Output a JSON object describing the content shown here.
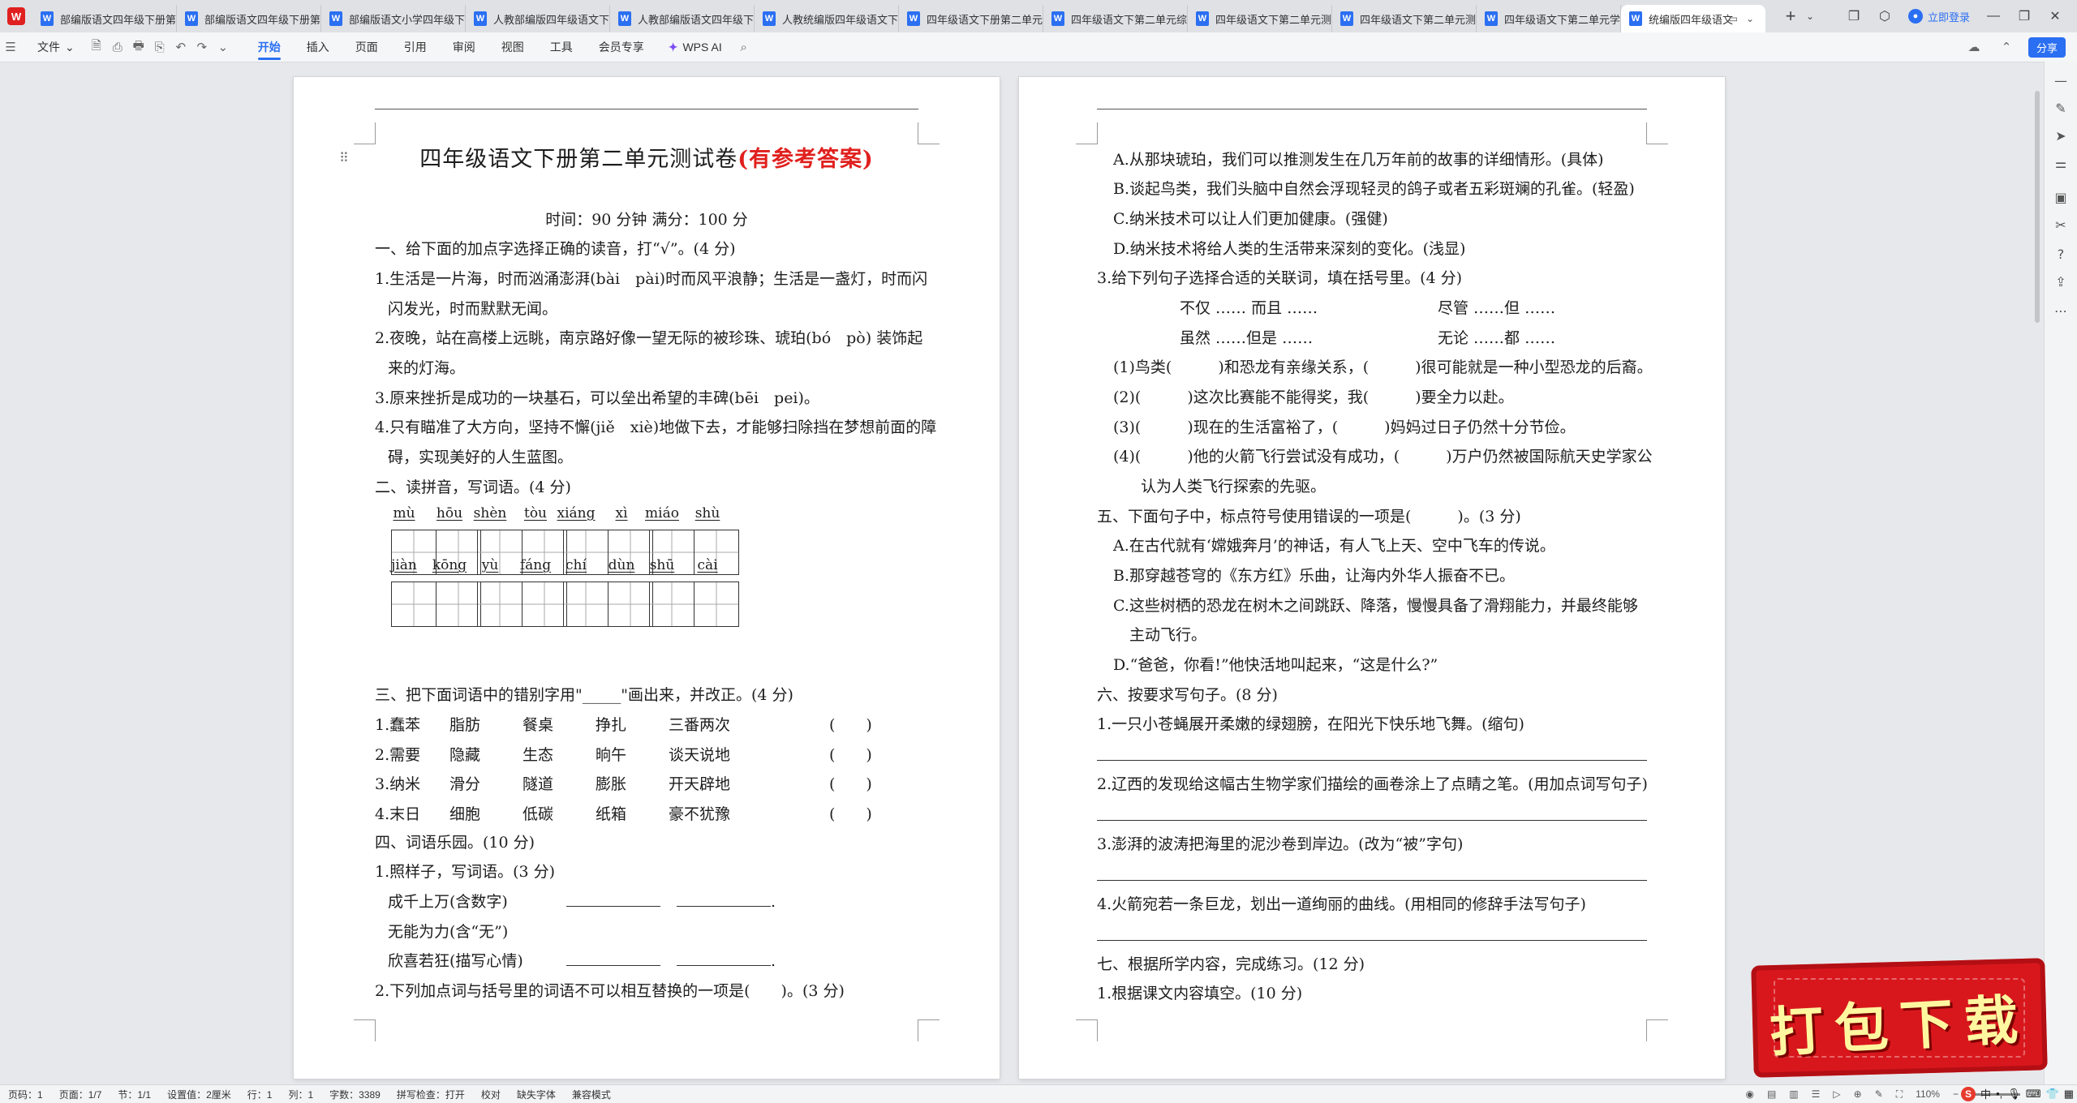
{
  "tabbar": {
    "tabs": [
      {
        "label": "部编版语文四年级下册第"
      },
      {
        "label": "部编版语文四年级下册第"
      },
      {
        "label": "部编版语文小学四年级下"
      },
      {
        "label": "人教部编版四年级语文下"
      },
      {
        "label": "人教部编版语文四年级下"
      },
      {
        "label": "人教统编版四年级语文下"
      },
      {
        "label": "四年级语文下册第二单元"
      },
      {
        "label": "四年级语文下第二单元综"
      },
      {
        "label": "四年级语文下第二单元测"
      },
      {
        "label": "四年级语文下第二单元测"
      },
      {
        "label": "四年级语文下第二单元学"
      },
      {
        "label": "统编版四年级语文"
      }
    ],
    "login": "立即登录"
  },
  "menubar": {
    "file": "文件",
    "items": [
      "开始",
      "插入",
      "页面",
      "引用",
      "审阅",
      "视图",
      "工具",
      "会员专享"
    ],
    "wpsai": "WPS AI",
    "share": "分享"
  },
  "left_page": {
    "title_main": "四年级语文下册第二单元测试卷",
    "title_red": "(有参考答案)",
    "time_line": "时间：90 分钟  满分：100 分",
    "s1": "一、给下面的加点字选择正确的读音，打“√”。(4 分)",
    "s1_1a": "1.生活是一片海，时而汹涌澎湃(bài　pài)时而风平浪静；生活是一盏灯，时而闪",
    "s1_1b": "闪发光，时而默默无闻。",
    "s1_2a": "2.夜晚，站在高楼上远眺，南京路好像一望无际的被珍珠、琥珀(bó　pò) 装饰起",
    "s1_2b": "来的灯海。",
    "s1_3": "3.原来挫折是成功的一块基石，可以垒出希望的丰碑(bēi　pei)。",
    "s1_4a": "4.只有瞄准了大方向，坚持不懈(jiě　xiè)地做下去，才能够扫除挡在梦想前面的障",
    "s1_4b": "碍，实现美好的人生蓝图。",
    "s2": "二、读拼音，写词语。(4 分)",
    "pinyin": [
      [
        "mù",
        "hōu"
      ],
      [
        "shèn",
        "tòu"
      ],
      [
        "xiáng",
        "xì"
      ],
      [
        "miáo",
        "shù"
      ],
      [
        "jiàn",
        "kōng"
      ],
      [
        "yù",
        "fáng"
      ],
      [
        "chí",
        "dùn"
      ],
      [
        "shū",
        "cài"
      ]
    ],
    "s3": "三、把下面词语中的错别字用\"_____\"画出来，并改正。(4 分)",
    "s3_rows": [
      [
        "1.蠢苯",
        "脂肪",
        "餐桌",
        "挣扎",
        "三番两次",
        "(　　)"
      ],
      [
        "2.需要",
        "隐藏",
        "生态",
        "晌午",
        "谈天说地",
        "(　　)"
      ],
      [
        "3.纳米",
        "滑分",
        "隧道",
        "膨胀",
        "开天辟地",
        "(　　)"
      ],
      [
        "4.末日",
        "细胞",
        "低碳",
        "纸箱",
        "豪不犹豫",
        "(　　)"
      ]
    ],
    "s4": "四、词语乐园。(10 分)",
    "s4_1": "1.照样子，写词语。(3 分)",
    "s4_1a": "成千上万(含数字)",
    "s4_1b": "无能为力(含“无”)",
    "s4_1c": "欣喜若狂(描写心情)",
    "s4_2": "2.下列加点词与括号里的词语不可以相互替换的一项是(　　)。(3 分)"
  },
  "right_page": {
    "a": "A.从那块琥珀，我们可以推测发生在几万年前的故事的详细情形。(具体)",
    "b": "B.谈起鸟类，我们头脑中自然会浮现轻灵的鸽子或者五彩斑斓的孔雀。(轻盈)",
    "c": "C.纳米技术可以让人们更加健康。(强健)",
    "d": "D.纳米技术将给人类的生活带来深刻的变化。(浅显)",
    "q3": "3.给下列句子选择合适的关联词，填在括号里。(4 分)",
    "conj1a": "不仅 …… 而且 ……",
    "conj1b": "尽管 ……但 ……",
    "conj2a": "虽然 ……但是 ……",
    "conj2b": "无论 ……都 ……",
    "q3_1": "(1)鸟类(　　　)和恐龙有亲缘关系，(　　　)很可能就是一种小型恐龙的后裔。",
    "q3_2": "(2)(　　　)这次比赛能不能得奖，我(　　　)要全力以赴。",
    "q3_3": "(3)(　　　)现在的生活富裕了，(　　　)妈妈过日子仍然十分节俭。",
    "q3_4a": "(4)(　　　)他的火箭飞行尝试没有成功，(　　　)万户仍然被国际航天史学家公",
    "q3_4b": "认为人类飞行探索的先驱。",
    "s5": "五、下面句子中，标点符号使用错误的一项是(　　　)。(3 分)",
    "s5a": "A.在古代就有‘嫦娥奔月’的神话，有人飞上天、空中飞车的传说。",
    "s5b": "B.那穿越苍穹的《东方红》乐曲，让海内外华人振奋不已。",
    "s5c1": "C.这些树栖的恐龙在树木之间跳跃、降落，慢慢具备了滑翔能力，并最终能够",
    "s5c2": "主动飞行。",
    "s5d": "D.“爸爸，你看!”他快活地叫起来，“这是什么?”",
    "s6": "六、按要求写句子。(8 分)",
    "s6_1": "1.一只小苍蝇展开柔嫩的绿翅膀，在阳光下快乐地飞舞。(缩句)",
    "s6_2": "2.辽西的发现给这幅古生物学家们描绘的画卷涂上了点睛之笔。(用加点词写句子)",
    "s6_3": "3.澎湃的波涛把海里的泥沙卷到岸边。(改为“被”字句)",
    "s6_4": "4.火箭宛若一条巨龙，划出一道绚丽的曲线。(用相同的修辞手法写句子)",
    "s7": "七、根据所学内容，完成练习。(12 分)",
    "s7_1": "1.根据课文内容填空。(10 分)"
  },
  "statusbar": {
    "items": [
      "页码：1",
      "页面：1/7",
      "节：1/1",
      "设置值：2厘米",
      "行：1",
      "列：1",
      "字数：3389",
      "拼写检查：打开",
      "校对",
      "缺失字体",
      "兼容模式"
    ],
    "zoom": "110%"
  },
  "badge": {
    "text": "打包下载"
  },
  "colors": {
    "accent": "#2b6ff2",
    "red_title": "#e0201e",
    "badge": "#d8171d"
  }
}
